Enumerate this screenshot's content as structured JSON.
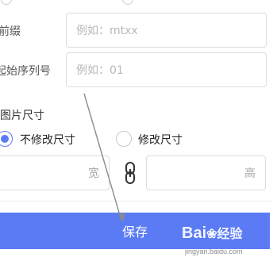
{
  "form": {
    "prefix_label": "前缀",
    "prefix_placeholder": "例如：mtxx",
    "start_seq_label": "起始序列号",
    "start_seq_placeholder": "例如：01"
  },
  "size_section": {
    "heading": "图片尺寸",
    "options": [
      {
        "label": "不修改尺寸",
        "selected": true
      },
      {
        "label": "修改尺寸",
        "selected": false
      }
    ],
    "width_label": "宽",
    "height_label": "高",
    "link_icon": "link-icon"
  },
  "footer": {
    "save_label": "保存",
    "accent_color": "#5b7bf5"
  },
  "watermark": {
    "brand": "Bai",
    "brand_tail": "经验",
    "site": "jingyan.baidu.com"
  }
}
